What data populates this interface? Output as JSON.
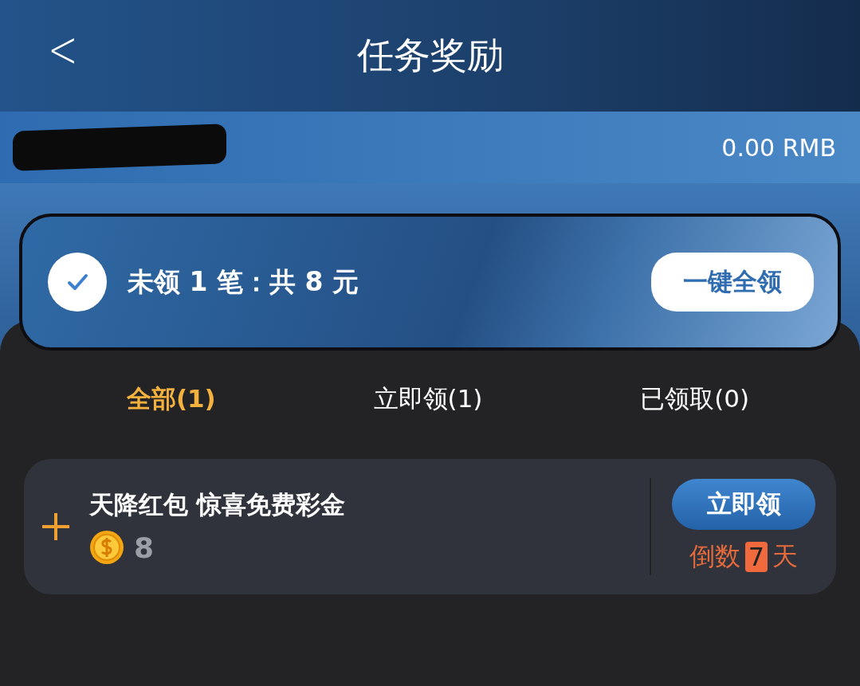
{
  "header": {
    "back": "<",
    "title": "任务奖励"
  },
  "balance": {
    "amount": "0.00 RMB"
  },
  "summary": {
    "checked": true,
    "text": "未领 1 笔：共 8 元",
    "button": "一键全领"
  },
  "tabs": [
    {
      "label": "全部(1)",
      "selected": true
    },
    {
      "label": "立即领(1)",
      "selected": false
    },
    {
      "label": "已领取(0)",
      "selected": false
    }
  ],
  "rewards": [
    {
      "title": "天降红包 惊喜免费彩金",
      "coins": "8",
      "button": "立即领",
      "countdown_prefix": "倒数",
      "days": "7",
      "countdown_suffix": "天"
    }
  ]
}
